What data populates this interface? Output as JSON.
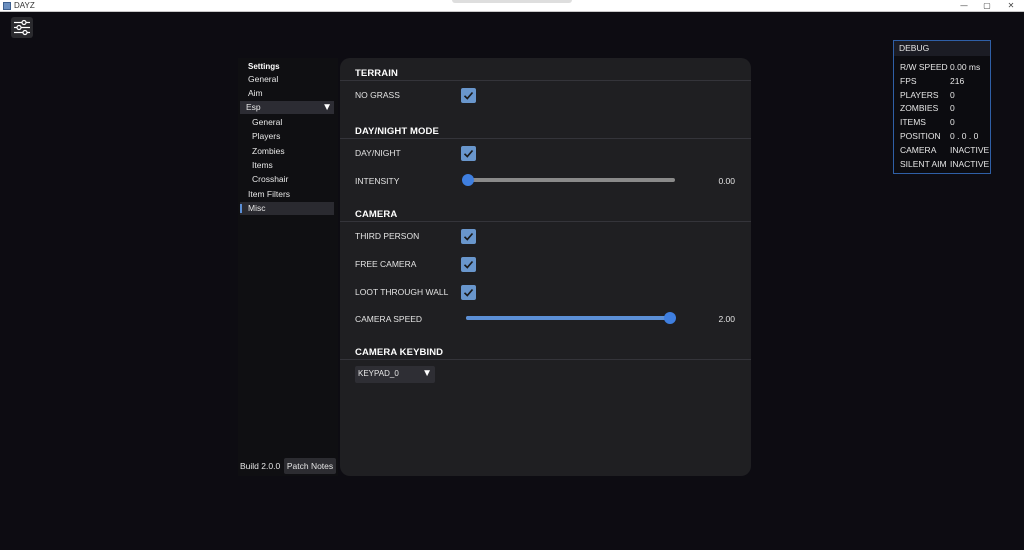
{
  "window": {
    "title": "DAYZ",
    "minimize": "—",
    "maximize": "▢",
    "close": "✕"
  },
  "sidebar": {
    "heading": "Settings",
    "items": [
      {
        "label": "General"
      },
      {
        "label": "Aim"
      },
      {
        "label": "Esp"
      },
      {
        "label": "General"
      },
      {
        "label": "Players"
      },
      {
        "label": "Zombies"
      },
      {
        "label": "Items"
      },
      {
        "label": "Crosshair"
      },
      {
        "label": "Item Filters"
      },
      {
        "label": "Misc"
      }
    ],
    "expand_caret": "▼"
  },
  "footer": {
    "build": "Build 2.0.0",
    "patch_notes": "Patch Notes"
  },
  "panel": {
    "terrain": {
      "title": "TERRAIN",
      "no_grass": {
        "label": "NO GRASS",
        "checked": true
      }
    },
    "day_night": {
      "title": "DAY/NIGHT MODE",
      "toggle": {
        "label": "DAY/NIGHT",
        "checked": true
      },
      "intensity": {
        "label": "INTENSITY",
        "value_text": "0.00",
        "value": 0.0,
        "min": 0.0,
        "max": 1.0
      }
    },
    "camera": {
      "title": "CAMERA",
      "third_person": {
        "label": "THIRD PERSON",
        "checked": true
      },
      "free_camera": {
        "label": "FREE CAMERA",
        "checked": true
      },
      "loot_through_wall": {
        "label": "LOOT THROUGH WALL",
        "checked": true
      },
      "speed": {
        "label": "CAMERA SPEED",
        "value_text": "2.00",
        "value": 2.0,
        "min": 0.0,
        "max": 2.0
      }
    },
    "keybind": {
      "title": "CAMERA KEYBIND",
      "selected": "KEYPAD_0",
      "caret": "▼"
    }
  },
  "debug": {
    "title": "DEBUG",
    "rows": [
      {
        "key": "R/W SPEED",
        "value": "0.00 ms"
      },
      {
        "key": "FPS",
        "value": "216"
      },
      {
        "key": "PLAYERS",
        "value": "0"
      },
      {
        "key": "ZOMBIES",
        "value": "0"
      },
      {
        "key": "ITEMS",
        "value": "0"
      },
      {
        "key": "POSITION",
        "value": "0 . 0 . 0"
      },
      {
        "key": "CAMERA",
        "value": "INACTIVE"
      },
      {
        "key": "SILENT AIM",
        "value": "INACTIVE"
      }
    ]
  },
  "colors": {
    "accent": "#5b8fd6",
    "checkbox": "#6996cc",
    "panel": "#1f1f22",
    "background": "#0d0c12",
    "debug_border": "#2f5fa6"
  },
  "icons": {
    "menu": "sliders-icon",
    "check": "checkmark-icon"
  }
}
